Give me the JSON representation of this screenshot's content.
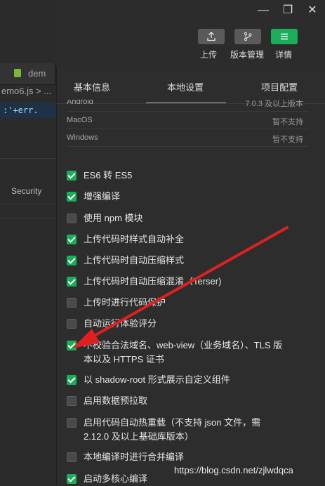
{
  "window_controls": {
    "minimize": "—",
    "maximize": "❐",
    "close": "✕"
  },
  "toolbar": {
    "upload_label": "上传",
    "version_label": "版本管理",
    "details_label": "详情"
  },
  "left_editor": {
    "tab_label": "dem",
    "file_label": "emo6.js > ...",
    "code_text": ":'+err.",
    "devtools_tab": "Security"
  },
  "tabs": [
    "基本信息",
    "本地设置",
    "项目配置"
  ],
  "active_tab": "本地设置",
  "os_rows": [
    {
      "name": "Android",
      "value": "7.0.3 及以上版本"
    },
    {
      "name": "MacOS",
      "value": "暂不支持"
    },
    {
      "name": "Windows",
      "value": "暂不支持"
    }
  ],
  "options": [
    {
      "label": "ES6 转 ES5",
      "checked": true
    },
    {
      "label": "增强编译",
      "checked": true
    },
    {
      "label": "使用 npm 模块",
      "checked": false
    },
    {
      "label": "上传代码时样式自动补全",
      "checked": true
    },
    {
      "label": "上传代码时自动压缩样式",
      "checked": true
    },
    {
      "label": "上传代码时自动压缩混淆（Terser)",
      "checked": true
    },
    {
      "label": "上传时进行代码保护",
      "checked": false
    },
    {
      "label": "自动运行体验评分",
      "checked": false
    },
    {
      "label": "不校验合法域名、web-view（业务域名）、TLS 版本以及 HTTPS 证书",
      "checked": true
    },
    {
      "label": "以 shadow-root 形式展示自定义组件",
      "checked": true
    },
    {
      "label": "启用数据预拉取",
      "checked": false
    },
    {
      "label": "启用代码自动热重载（不支持 json 文件，需 2.12.0 及以上基础库版本）",
      "checked": false
    },
    {
      "label": "本地编译时进行合并编译",
      "checked": false
    },
    {
      "label": "启动多核心编译",
      "checked": true
    }
  ],
  "watermark": "https://blog.csdn.net/zjlwdqca",
  "colors": {
    "accent": "#1aad5a",
    "arrow": "#e02020",
    "panel_bg": "#2d2d2d"
  }
}
